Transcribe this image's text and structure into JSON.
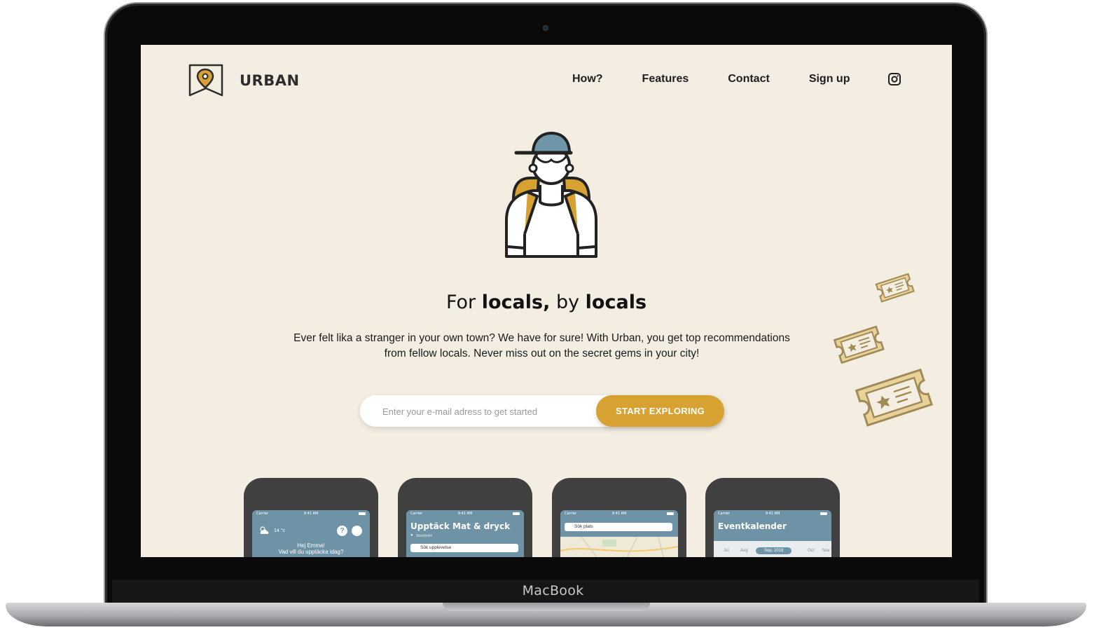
{
  "device": {
    "label": "MacBook"
  },
  "header": {
    "brand": "URBAN",
    "nav": [
      {
        "label": "How?"
      },
      {
        "label": "Features"
      },
      {
        "label": "Contact"
      },
      {
        "label": "Sign up"
      }
    ],
    "social_icon": "instagram-icon"
  },
  "hero": {
    "headline_parts": [
      "For ",
      "locals,",
      " by ",
      "locals"
    ],
    "tagline_line1": "Ever felt lika a stranger in your own town? We have for sure! With Urban, you get top recommendations",
    "tagline_line2": "from fellow locals. Never miss out on the secret gems in your city!",
    "email_placeholder": "Enter your e-mail adress to get started",
    "cta_label": "START EXPLORING"
  },
  "phones": [
    {
      "status_left": "Carrier",
      "status_time": "9:41 AM",
      "temp": "14 °c",
      "greeting_line1": "Hej Emma!",
      "greeting_line2": "Vad vill du upptäcka idag?"
    },
    {
      "status_left": "Carrier",
      "status_time": "9:41 AM",
      "title": "Upptäck Mat & dryck",
      "location": "Stockholm",
      "search": "Sök upplevelse"
    },
    {
      "status_left": "Carrier",
      "status_time": "9:41 AM",
      "search": "Sök plats"
    },
    {
      "status_left": "Carrier",
      "status_time": "9:41 AM",
      "title": "Eventkalender",
      "months": [
        "Jul",
        "Aug",
        "Sep, 2019",
        "Oct",
        "Nov"
      ]
    }
  ],
  "colors": {
    "background": "#f4eee2",
    "accent": "#d8a233",
    "phone_screen": "#6f93a6",
    "cap": "#6e95a8",
    "ticket": "#e8d29a"
  }
}
